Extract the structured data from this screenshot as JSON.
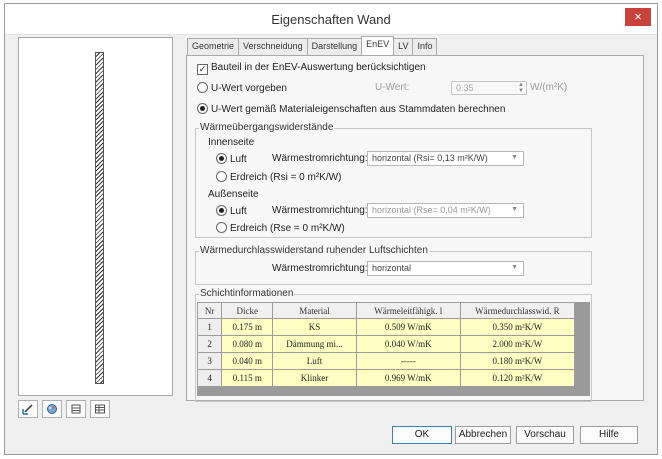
{
  "window": {
    "title": "Eigenschaften Wand",
    "close_label": "×"
  },
  "tabs": [
    "Geometrie",
    "Verschneidung",
    "Darstellung",
    "EnEV",
    "LV",
    "Info"
  ],
  "enev": {
    "include_checkbox": {
      "label": "Bauteil in der EnEV-Auswertung berücksichtigen",
      "checked": true
    },
    "radio_u_value": {
      "label": "U-Wert vorgeben",
      "selected": false
    },
    "u_value": {
      "label": "U-Wert:",
      "value": "0.35",
      "unit": "W/(m²K)"
    },
    "radio_material": {
      "label": "U-Wert gemäß Materialeigenschaften aus Stammdaten berechnen",
      "selected": true
    }
  },
  "heat_transfer": {
    "group_label": "Wärmeübergangswiderstände",
    "inside": {
      "label": "Innenseite",
      "luft_label": "Luft",
      "direction_label": "Wärmestromrichtung:",
      "direction_value": "horizontal (Rsi= 0,13 m²K/W)",
      "erdreich_label": "Erdreich (Rsi = 0 m²K/W)"
    },
    "outside": {
      "label": "Außenseite",
      "luft_label": "Luft",
      "direction_label": "Wärmestromrichtung:",
      "direction_value": "horizontal (Rse= 0,04 m²K/W)",
      "erdreich_label": "Erdreich (Rse = 0 m²K/W)"
    }
  },
  "air_layers": {
    "group_label": "Wärmedurchlasswiderstand ruhender Luftschichten",
    "direction_label": "Wärmestromrichtung:",
    "direction_value": "horizontal"
  },
  "layers": {
    "group_label": "Schichtinformationen",
    "headers": [
      "Nr",
      "Dicke",
      "Material",
      "Wärmeleitfähigk. l",
      "Wärmedurchlasswid. R"
    ],
    "rows": [
      [
        "1",
        "0.175 m",
        "KS",
        "0.509 W/mK",
        "0.350 m²K/W"
      ],
      [
        "2",
        "0.080 m",
        "Dämmung mi...",
        "0.040 W/mK",
        "2.000 m²K/W"
      ],
      [
        "3",
        "0.040 m",
        "Luft",
        "-----",
        "0.180 m²K/W"
      ],
      [
        "4",
        "0.115 m",
        "Klinker",
        "0.969 W/mK",
        "0.120 m²K/W"
      ]
    ]
  },
  "buttons": {
    "ok": "OK",
    "cancel": "Abbrechen",
    "preview": "Vorschau",
    "help": "Hilfe"
  },
  "colors": {
    "close": "#c8413a",
    "cell_highlight": "#ffffc4",
    "default_button_border": "#3c7fb1"
  }
}
